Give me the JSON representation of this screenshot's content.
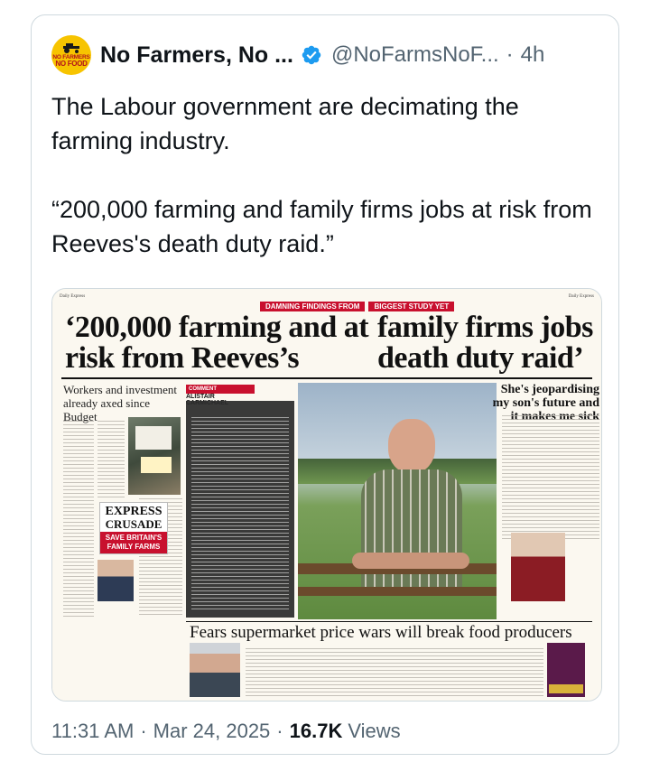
{
  "tweet": {
    "author_name": "No Farmers, No ...",
    "handle": "@NoFarmsNoF...",
    "separator": "·",
    "relative_time": "4h",
    "avatar_text_line1": "NO FARMERS",
    "avatar_text_line2": "NO FOOD",
    "text_paragraphs": [
      "The Labour government are decimating the farming industry.",
      "“200,000 farming and family firms jobs at risk from Reeves's death duty raid.”"
    ],
    "timestamp_time": "11:31 AM",
    "timestamp_date": "Mar 24, 2025",
    "views_count": "16.7K",
    "views_label": "Views",
    "colors": {
      "verified": "#1d9bf0",
      "text": "#0f1419",
      "secondary": "#536471",
      "border": "#cfd9de",
      "accent_red": "#c8102e"
    }
  },
  "media": {
    "kicker_left": "DAMNING FINDINGS FROM",
    "kicker_right": "BIGGEST STUDY YET",
    "headline_left": "‘200,000 farming and at risk from Reeves’s",
    "headline_right": "family firms jobs death duty raid’",
    "subhead": "Workers and investment already axed since Budget",
    "express_line1": "EXPRESS",
    "express_line2": "CRUSADE",
    "express_line3": "SAVE BRITAIN'S FAMILY FARMS",
    "comment_label": "COMMENT",
    "comment_author": "ALISTAIR CARMICHAEL",
    "quote_head": "She's jeopardising my son's future and it makes me sick",
    "lower_head": "Fears supermarket price wars will break food producers"
  }
}
